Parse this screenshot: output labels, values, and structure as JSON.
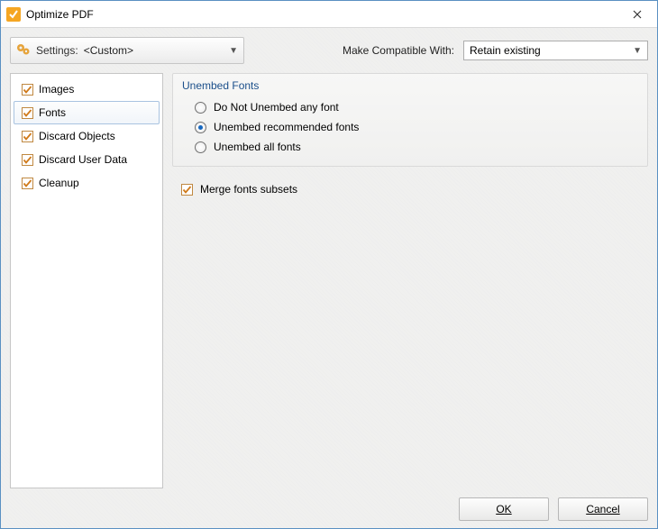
{
  "window": {
    "title": "Optimize PDF"
  },
  "toprow": {
    "settings_label": "Settings:",
    "settings_value": "<Custom>",
    "compat_label": "Make Compatible With:",
    "compat_value": "Retain existing"
  },
  "sidebar": {
    "items": [
      {
        "label": "Images",
        "checked": true,
        "selected": false
      },
      {
        "label": "Fonts",
        "checked": true,
        "selected": true
      },
      {
        "label": "Discard Objects",
        "checked": true,
        "selected": false
      },
      {
        "label": "Discard User Data",
        "checked": true,
        "selected": false
      },
      {
        "label": "Cleanup",
        "checked": true,
        "selected": false
      }
    ]
  },
  "main": {
    "group_title": "Unembed Fonts",
    "radios": [
      {
        "label": "Do Not Unembed any font",
        "selected": false
      },
      {
        "label": "Unembed recommended fonts",
        "selected": true
      },
      {
        "label": "Unembed all fonts",
        "selected": false
      }
    ],
    "merge_label": "Merge fonts subsets",
    "merge_checked": true
  },
  "footer": {
    "ok": "OK",
    "cancel": "Cancel"
  }
}
